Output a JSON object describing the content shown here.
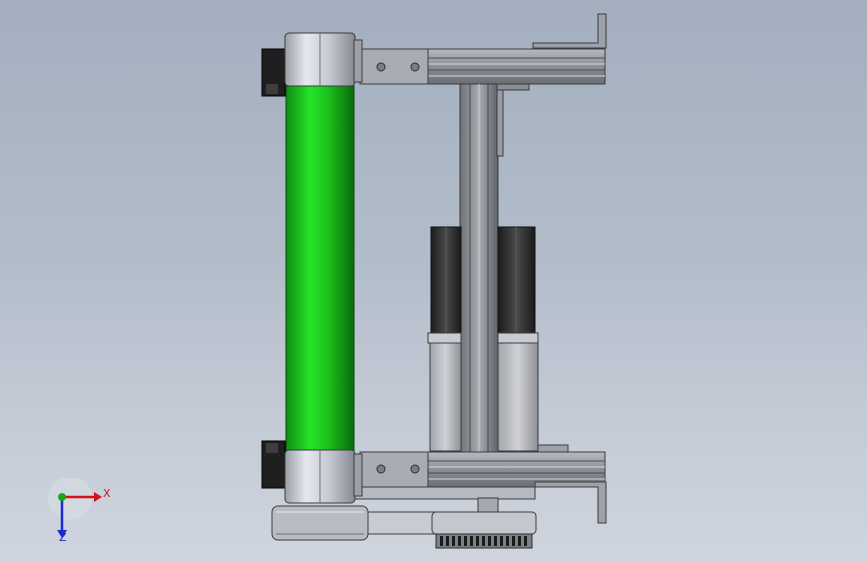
{
  "viewport": {
    "background_top": "#a3afbf",
    "background_bottom": "#cfd5de"
  },
  "model": {
    "roller_color": "#19c019",
    "frame_color": "#8f9296",
    "motor_color": "#2c2c2c",
    "cap_color": "#c8cbd3"
  },
  "triad": {
    "x_label": "X",
    "z_label": "Z",
    "x_color": "#d0141a",
    "y_color": "#18a818",
    "z_color": "#1a2ad0"
  }
}
